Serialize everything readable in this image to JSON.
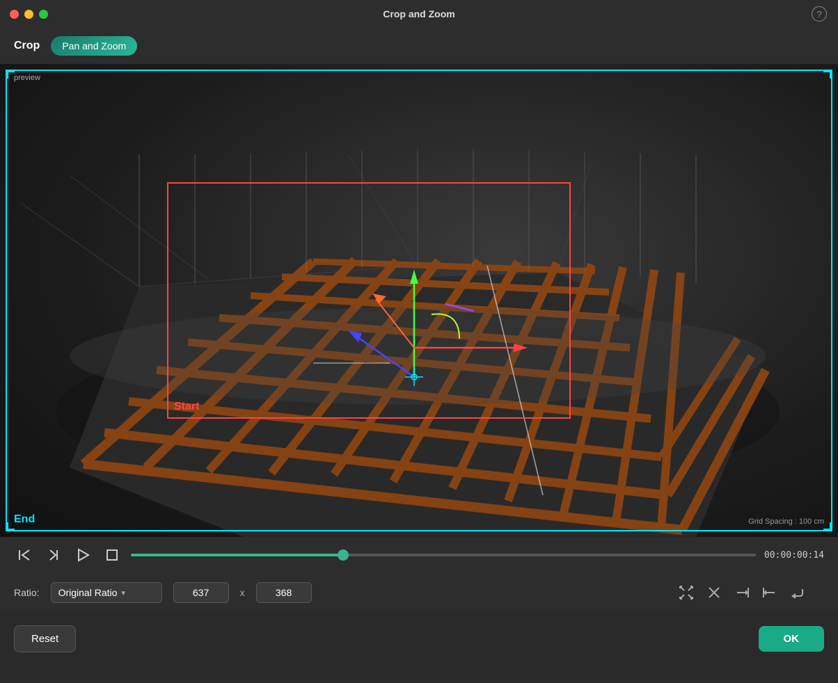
{
  "window": {
    "title": "Crop and Zoom",
    "help_icon": "?"
  },
  "toolbar": {
    "crop_label": "Crop",
    "pan_zoom_label": "Pan and Zoom"
  },
  "video": {
    "preview_label": "preview",
    "grid_spacing_label": "Grid Spacing : 100 cm",
    "crop_start_label": "Start",
    "crop_end_label": "End"
  },
  "playback": {
    "time": "00:00:00:14"
  },
  "ratio": {
    "label": "Ratio:",
    "value": "Original Ratio",
    "width": "637",
    "height": "368",
    "x_separator": "x"
  },
  "icons": {
    "fit_icon": "⊹",
    "close_icon": "✕",
    "arrow_in_icon": "⇥",
    "arrow_out_icon": "⇤",
    "return_icon": "↩"
  },
  "buttons": {
    "reset_label": "Reset",
    "ok_label": "OK"
  }
}
